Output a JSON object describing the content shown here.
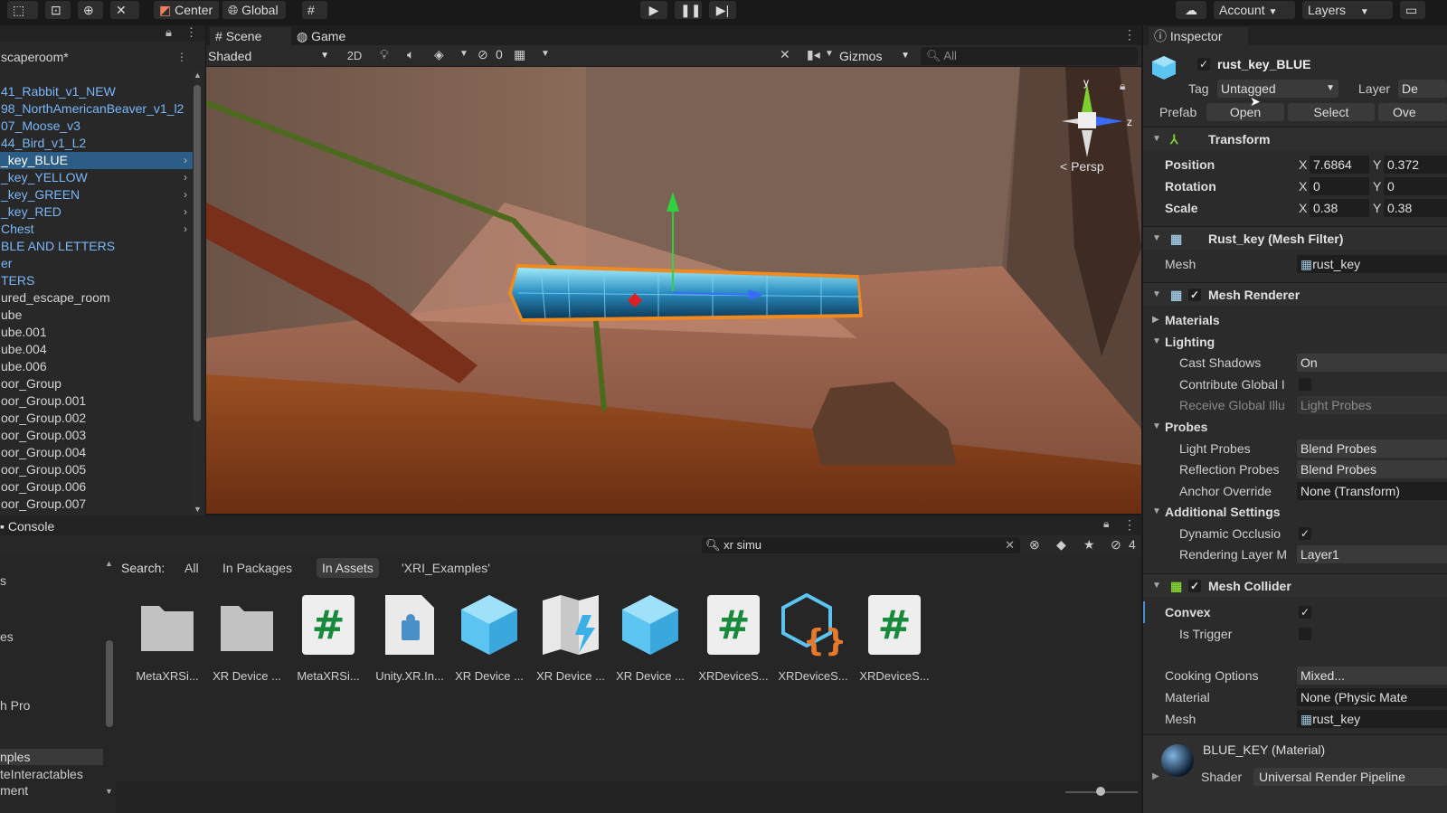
{
  "toolbar": {
    "pivot_label": "Center",
    "space_label": "Global",
    "account_label": "Account",
    "layers_label": "Layers"
  },
  "hierarchy": {
    "items": [
      {
        "label": "scaperoom*",
        "style": "white"
      },
      {
        "label": "41_Rabbit_v1_NEW",
        "style": "blue"
      },
      {
        "label": "98_NorthAmericanBeaver_v1_l2",
        "style": "blue"
      },
      {
        "label": "07_Moose_v3",
        "style": "blue"
      },
      {
        "label": "44_Bird_v1_L2",
        "style": "blue"
      },
      {
        "label": "_key_BLUE",
        "style": "sel",
        "arrow": true
      },
      {
        "label": "_key_YELLOW",
        "style": "blue",
        "arrow": true
      },
      {
        "label": "_key_GREEN",
        "style": "blue",
        "arrow": true
      },
      {
        "label": "_key_RED",
        "style": "blue",
        "arrow": true
      },
      {
        "label": "Chest",
        "style": "blue",
        "arrow": true
      },
      {
        "label": "BLE AND LETTERS",
        "style": "blue"
      },
      {
        "label": "er",
        "style": "blue"
      },
      {
        "label": "TERS",
        "style": "blue"
      },
      {
        "label": "ured_escape_room",
        "style": "white"
      },
      {
        "label": "ube",
        "style": "white"
      },
      {
        "label": "ube.001",
        "style": "white"
      },
      {
        "label": "ube.004",
        "style": "white"
      },
      {
        "label": "ube.006",
        "style": "white"
      },
      {
        "label": "oor_Group",
        "style": "white"
      },
      {
        "label": "oor_Group.001",
        "style": "white"
      },
      {
        "label": "oor_Group.002",
        "style": "white"
      },
      {
        "label": "oor_Group.003",
        "style": "white"
      },
      {
        "label": "oor_Group.004",
        "style": "white"
      },
      {
        "label": "oor_Group.005",
        "style": "white"
      },
      {
        "label": "oor_Group.006",
        "style": "white"
      },
      {
        "label": "oor_Group.007",
        "style": "white"
      }
    ]
  },
  "scene": {
    "tab_scene": "Scene",
    "tab_game": "Game",
    "shading": "Shaded",
    "mode_2d": "2D",
    "hidden_count": "0",
    "gizmos": "Gizmos",
    "search_placeholder": "All",
    "gizmo_y": "y",
    "gizmo_z": "z",
    "persp": "< Persp"
  },
  "console": {
    "tab": "Console"
  },
  "project": {
    "search_value": "xr simu",
    "filter_count": "4",
    "search_label": "Search:",
    "scopes": [
      "All",
      "In Packages",
      "In Assets",
      "'XRI_Examples'"
    ],
    "left_items": [
      "s",
      "es",
      "h Pro",
      "nples",
      "teInteractables",
      "ment"
    ],
    "assets": [
      {
        "label": "MetaXRSi...",
        "icon": "folder-icon"
      },
      {
        "label": "XR Device ...",
        "icon": "folder-icon"
      },
      {
        "label": "MetaXRSi...",
        "icon": "cs-script-icon"
      },
      {
        "label": "Unity.XR.In...",
        "icon": "assembly-definition-icon"
      },
      {
        "label": "XR Device ...",
        "icon": "prefab-icon"
      },
      {
        "label": "XR Device ...",
        "icon": "xr-map-icon"
      },
      {
        "label": "XR Device ...",
        "icon": "prefab-icon"
      },
      {
        "label": "XRDeviceS...",
        "icon": "cs-script-icon"
      },
      {
        "label": "XRDeviceS...",
        "icon": "json-prefab-icon"
      },
      {
        "label": "XRDeviceS...",
        "icon": "cs-script-icon"
      }
    ]
  },
  "inspector": {
    "tab": "Inspector",
    "object_name": "rust_key_BLUE",
    "tag_label": "Tag",
    "tag_value": "Untagged",
    "layer_label": "Layer",
    "layer_value": "De",
    "prefab_label": "Prefab",
    "prefab_open": "Open",
    "prefab_select": "Select",
    "prefab_overrides": "Ove",
    "transform": {
      "title": "Transform",
      "position_label": "Position",
      "position_x": "7.6864",
      "position_y": "0.372",
      "rotation_label": "Rotation",
      "rotation_x": "0",
      "rotation_y": "0",
      "scale_label": "Scale",
      "scale_x": "0.38",
      "scale_y": "0.38",
      "x": "X",
      "y": "Y"
    },
    "mesh_filter": {
      "title": "Rust_key (Mesh Filter)",
      "mesh_label": "Mesh",
      "mesh_value": "rust_key"
    },
    "mesh_renderer": {
      "title": "Mesh Renderer",
      "materials": "Materials",
      "lighting": "Lighting",
      "cast_shadows_label": "Cast Shadows",
      "cast_shadows_value": "On",
      "contribute_gi_label": "Contribute Global I",
      "receive_gi_label": "Receive Global Illu",
      "receive_gi_value": "Light Probes",
      "probes": "Probes",
      "light_probes_label": "Light Probes",
      "light_probes_value": "Blend Probes",
      "reflection_probes_label": "Reflection Probes",
      "reflection_probes_value": "Blend Probes",
      "anchor_override_label": "Anchor Override",
      "anchor_override_value": "None (Transform)",
      "additional_settings": "Additional Settings",
      "dynamic_occlusion_label": "Dynamic Occlusio",
      "rendering_layer_label": "Rendering Layer M",
      "rendering_layer_value": "Layer1"
    },
    "mesh_collider": {
      "title": "Mesh Collider",
      "convex_label": "Convex",
      "is_trigger_label": "Is Trigger",
      "cooking_options_label": "Cooking Options",
      "cooking_options_value": "Mixed...",
      "material_label": "Material",
      "material_value": "None (Physic Mate",
      "mesh_label": "Mesh",
      "mesh_value": "rust_key"
    },
    "material": {
      "name": "BLUE_KEY (Material)",
      "shader_label": "Shader",
      "shader_value": "Universal Render Pipeline"
    }
  },
  "colors": {
    "selection": "#2c5d87",
    "prefab_blue": "#7ab7f8",
    "panel": "#282828"
  }
}
